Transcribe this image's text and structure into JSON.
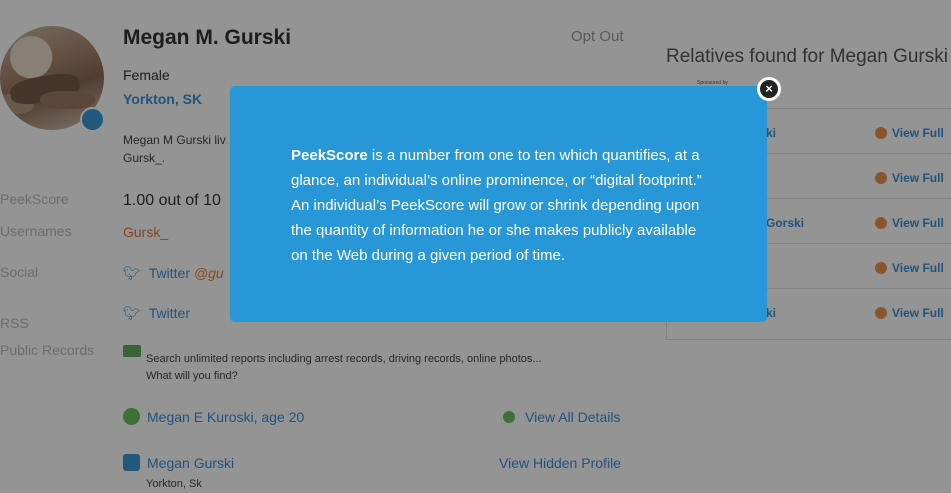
{
  "profile": {
    "name": "Megan M. Gurski",
    "opt_out": "Opt Out",
    "gender": "Female",
    "location": "Yorkton, SK",
    "bio_line1": "Megan M Gurski liv",
    "bio_line2": "Gursk_."
  },
  "side_labels": {
    "peekscore": "PeekScore",
    "usernames": "Usernames",
    "social": "Social",
    "rss": "RSS",
    "public_records": "Public Records"
  },
  "peekscore_value": "1.00 out of 10",
  "username": "Gursk_",
  "social": {
    "twitter1_label": "Twitter",
    "twitter1_handle": "@gu",
    "twitter2_label": "Twitter"
  },
  "search_promo": {
    "line1": "Search unlimited reports including arrest records, driving records, online photos...",
    "line2": "What will you find?"
  },
  "records": [
    {
      "name": "Megan E Kuroski, age 20",
      "action": "View All Details"
    },
    {
      "name": "Megan Gurski",
      "action": "View Hidden Profile",
      "location": "Yorkton, Sk"
    }
  ],
  "relatives": {
    "title": "Relatives found for Megan Gurski",
    "sponsored": "Sponsored by",
    "rows": [
      {
        "name": "ki",
        "action": "View Full"
      },
      {
        "name": "",
        "action": "View Full"
      },
      {
        "name": "Gorski",
        "action": "View Full"
      },
      {
        "name": "",
        "action": "View Full"
      },
      {
        "name": "ki",
        "action": "View Full"
      }
    ]
  },
  "modal": {
    "term": "PeekScore",
    "text": " is a number from one to ten which quantifies, at a glance, an individual’s online prominence, or “digital footprint.” An individual’s PeekScore will grow or shrink depending upon the quantity of information he or she makes publicly available on the Web during a given period of time.",
    "close_icon": "×"
  }
}
